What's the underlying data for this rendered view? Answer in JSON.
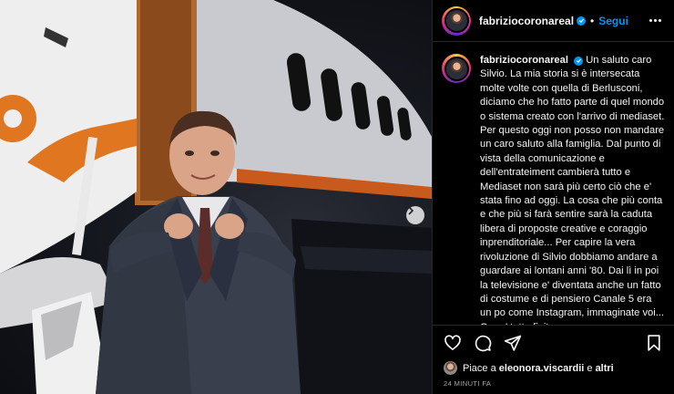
{
  "post": {
    "username": "fabriziocoronareal",
    "separator": "•",
    "follow_label": "Segui",
    "caption_username": "fabriziocoronareal",
    "caption": "Un saluto caro Silvio. La mia storia si è intersecata molte volte con quella di Berlusconi, diciamo che ho fatto parte di quel mondo o sistema creato con l'arrivo di mediaset. Per questo oggi non posso non mandare un caro saluto alla famiglia. Dal punto di vista della comunicazione e dell'entrateiment cambierà tutto e Mediaset non sarà più certo ciò che e' stata fino ad oggi. La cosa che più conta e che più si farà sentire sarà la caduta libera di proposte creative e coraggio inprenditoriale... Per capire la vera rivoluzione di Silvio dobbiamo andare a guardare ai lontani anni '80. Dai lì in poi la televisione e' diventata anche un fatto di costume e di pensiero Canale 5 era un po come Instagram, immaginate voi... Ora e' tutto finito.",
    "likes_prefix": "Piace a ",
    "likes_user": "eleonora.viscardii",
    "likes_suffix": " e ",
    "likes_others": "altri",
    "timestamp": "24 MINUTI FA"
  },
  "icons": {
    "verified": "verified-badge-icon",
    "more": "more-options-icon",
    "like": "heart-icon",
    "comment": "comment-icon",
    "share": "send-icon",
    "save": "bookmark-icon",
    "next": "chevron-right-icon"
  },
  "colors": {
    "accent": "#0095f6",
    "background": "#000000",
    "text": "#f5f5f5",
    "muted": "#a8a8a8"
  }
}
